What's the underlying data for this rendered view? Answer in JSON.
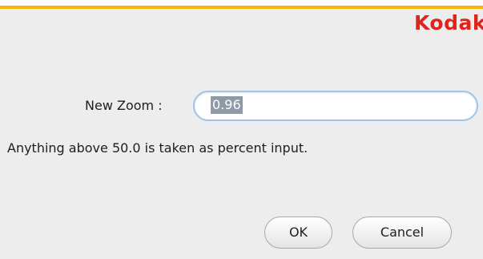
{
  "brand": {
    "logo_text": "Kodak",
    "accent_color": "#f5b50c",
    "logo_color": "#e2231a"
  },
  "zoom": {
    "label": "New Zoom :",
    "value": "0.96",
    "hint": "Anything above 50.0 is taken as percent input."
  },
  "buttons": {
    "ok_label": "OK",
    "cancel_label": "Cancel"
  }
}
